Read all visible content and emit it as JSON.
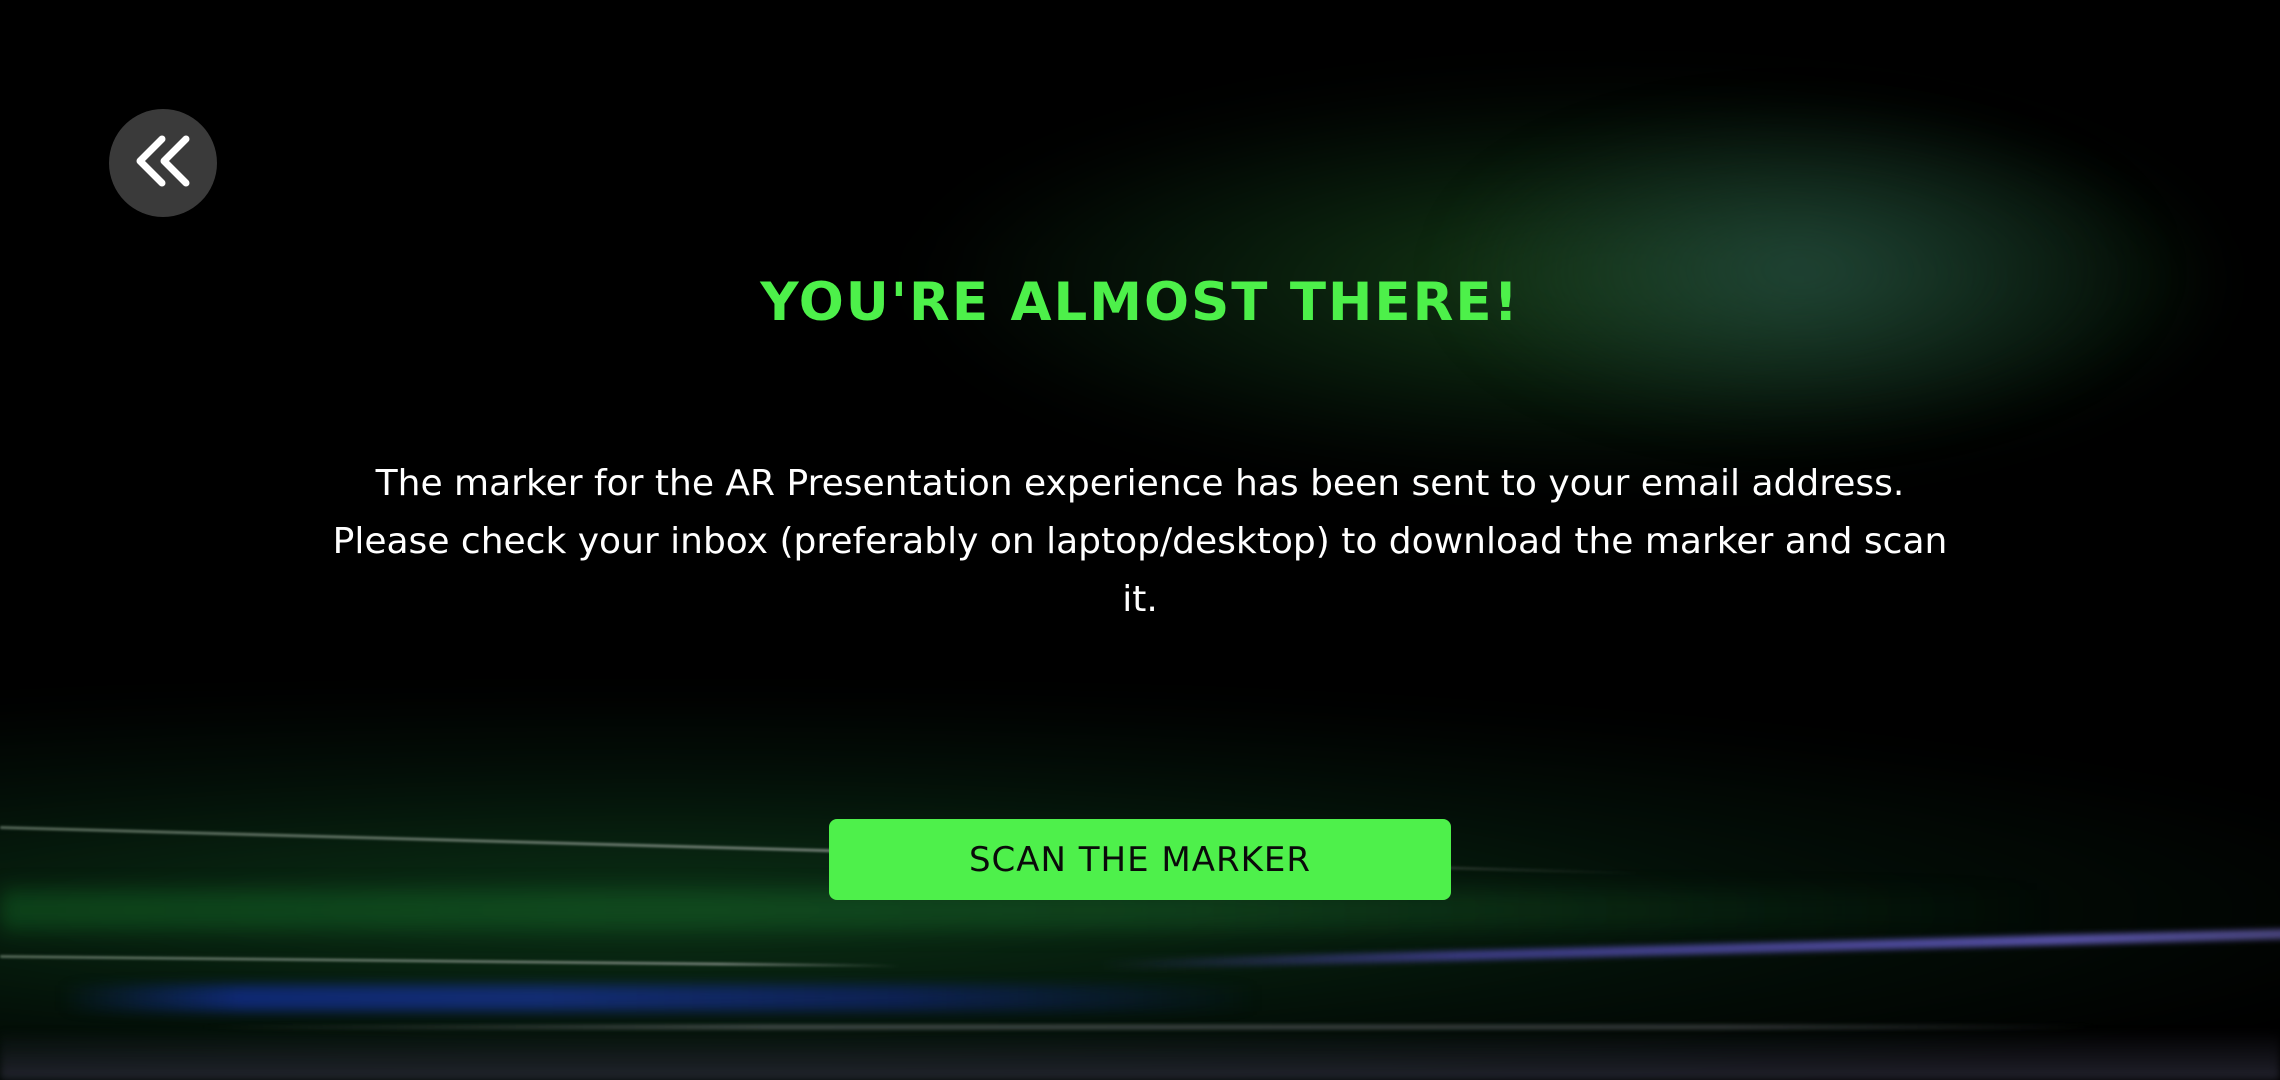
{
  "header": {
    "back_button": {
      "icon": "double-chevron-left-icon",
      "background": "#3a3a3a",
      "icon_color": "#ffffff"
    }
  },
  "main": {
    "title": "YOU'RE ALMOST THERE!",
    "message": "The marker for the AR Presentation experience has been sent to your email address. Please check your inbox (preferably on laptop/desktop) to download the marker and scan it.",
    "cta_label": "SCAN THE MARKER"
  },
  "colors": {
    "accent": "#4ef04b",
    "background": "#000000",
    "text": "#ffffff"
  }
}
